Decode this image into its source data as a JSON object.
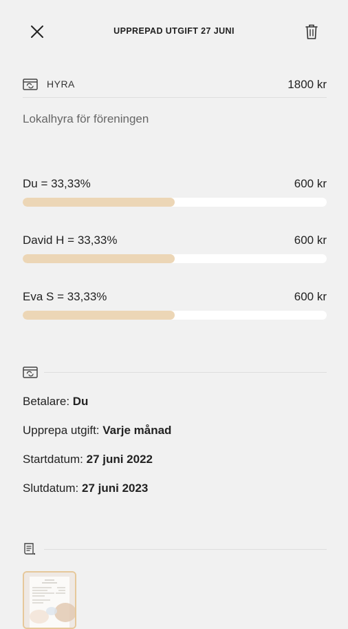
{
  "header": {
    "title": "UPPREPAD UTGIFT 27 JUNI"
  },
  "expense": {
    "category": "HYRA",
    "amount": "1800 kr",
    "description": "Lokalhyra för föreningen"
  },
  "shares": [
    {
      "name": "Du = 33,33%",
      "amount": "600 kr",
      "fraction": 0.5
    },
    {
      "name": "David H = 33,33%",
      "amount": "600 kr",
      "fraction": 0.5
    },
    {
      "name": "Eva S = 33,33%",
      "amount": "600 kr",
      "fraction": 0.5
    }
  ],
  "details": {
    "payer_label": "Betalare:",
    "payer_value": "Du",
    "repeat_label": "Upprepa utgift:",
    "repeat_value": "Varje månad",
    "start_label": "Startdatum:",
    "start_value": "27 juni 2022",
    "end_label": "Slutdatum:",
    "end_value": "27 juni 2023"
  },
  "colors": {
    "bar_fill": "#ecd6b6",
    "bar_track": "#ffffff",
    "background": "#f1f1f1",
    "thumb_border": "#e6c89a"
  },
  "icons": [
    "close-icon",
    "trash-icon",
    "bill-icon",
    "receipt-icon"
  ]
}
